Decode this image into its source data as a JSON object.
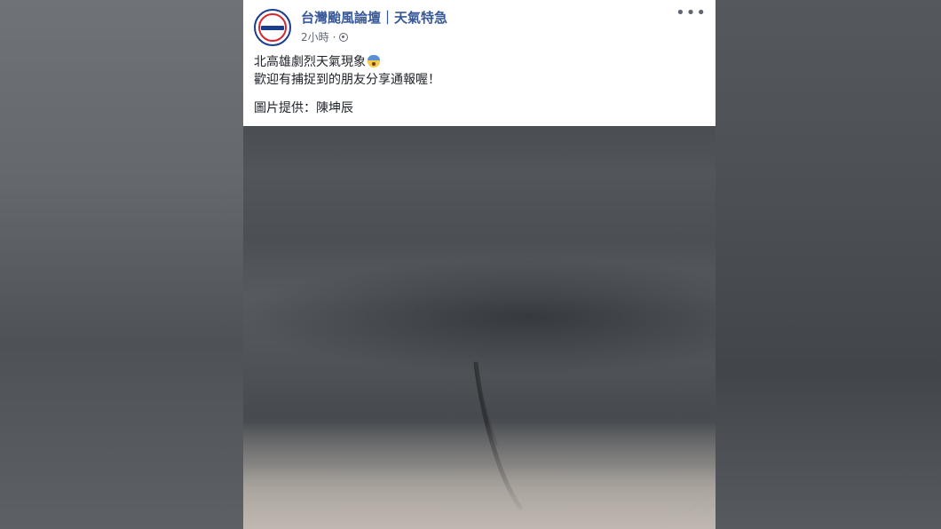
{
  "post": {
    "page_name": "台灣颱風論壇｜天氣特急",
    "time": "2小時",
    "separator": "·",
    "text_line1": "北高雄劇烈天氣現象",
    "text_line2": "歡迎有捕捉到的朋友分享通報喔！",
    "credit": "圖片提供：陳坤辰",
    "more_label": "•••"
  },
  "colors": {
    "link": "#385898",
    "meta": "#606770",
    "text": "#1d2129"
  },
  "icons": {
    "privacy": "globe-icon",
    "emoji": "anxious-face-emoji",
    "menu": "more-options-icon"
  }
}
